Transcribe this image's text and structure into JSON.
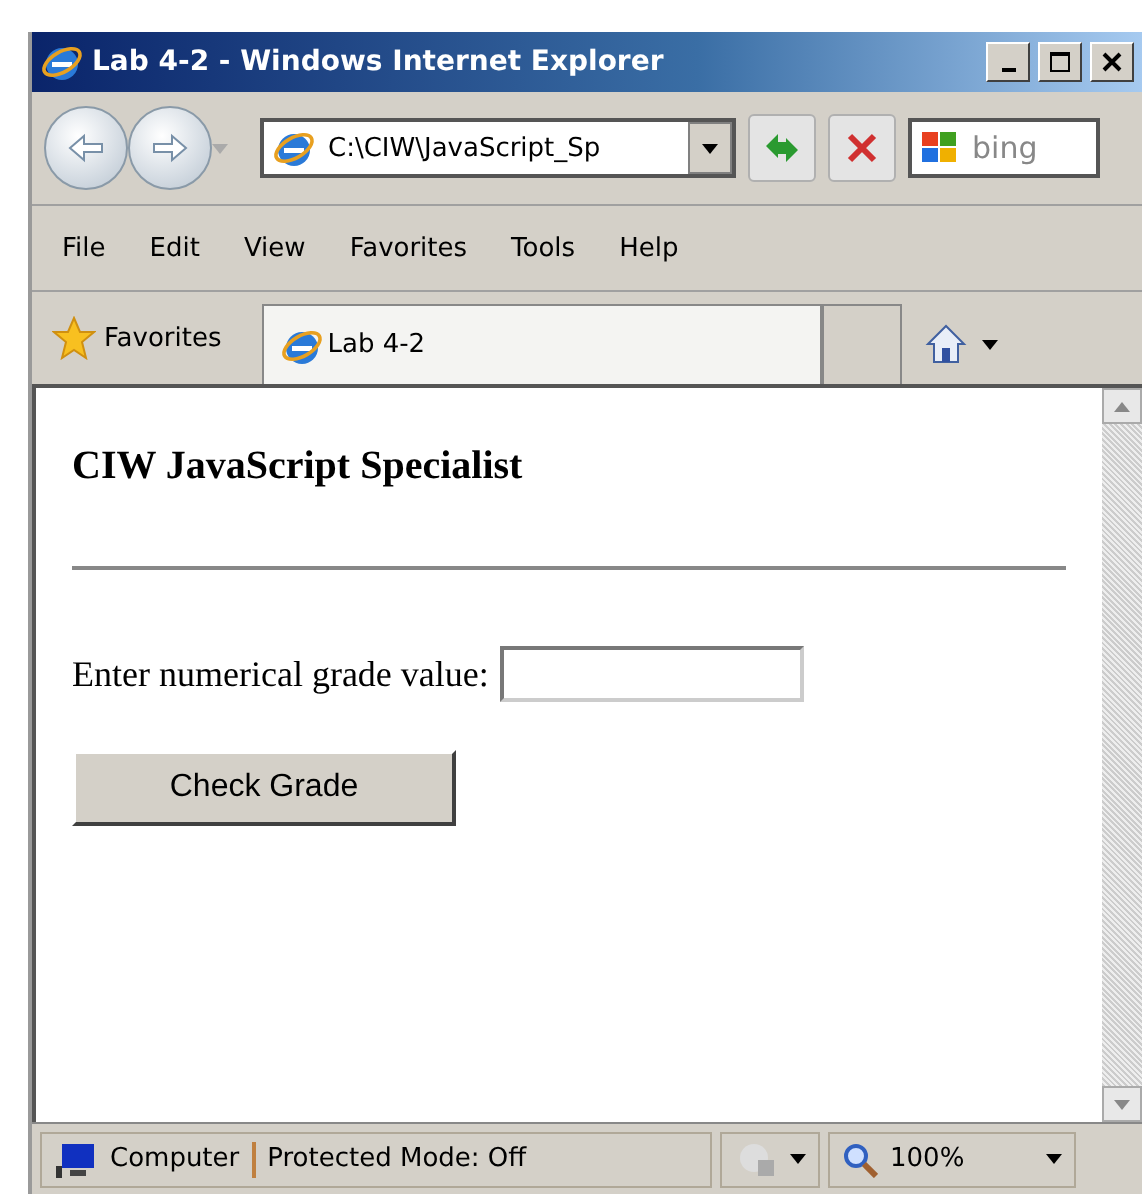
{
  "window": {
    "title": "Lab 4-2 - Windows Internet Explorer"
  },
  "address_bar": {
    "value": "C:\\CIW\\JavaScript_Sp"
  },
  "search": {
    "placeholder": "bing"
  },
  "menu": [
    "File",
    "Edit",
    "View",
    "Favorites",
    "Tools",
    "Help"
  ],
  "favorites_bar": {
    "label": "Favorites"
  },
  "tabs": [
    {
      "label": "Lab 4-2",
      "selected": true
    }
  ],
  "page": {
    "heading": "CIW JavaScript Specialist",
    "field_label": "Enter numerical grade value:",
    "button": "Check Grade"
  },
  "status_bar": {
    "zone": "Computer",
    "mode": "Protected Mode: Off",
    "zoom": "100%"
  }
}
